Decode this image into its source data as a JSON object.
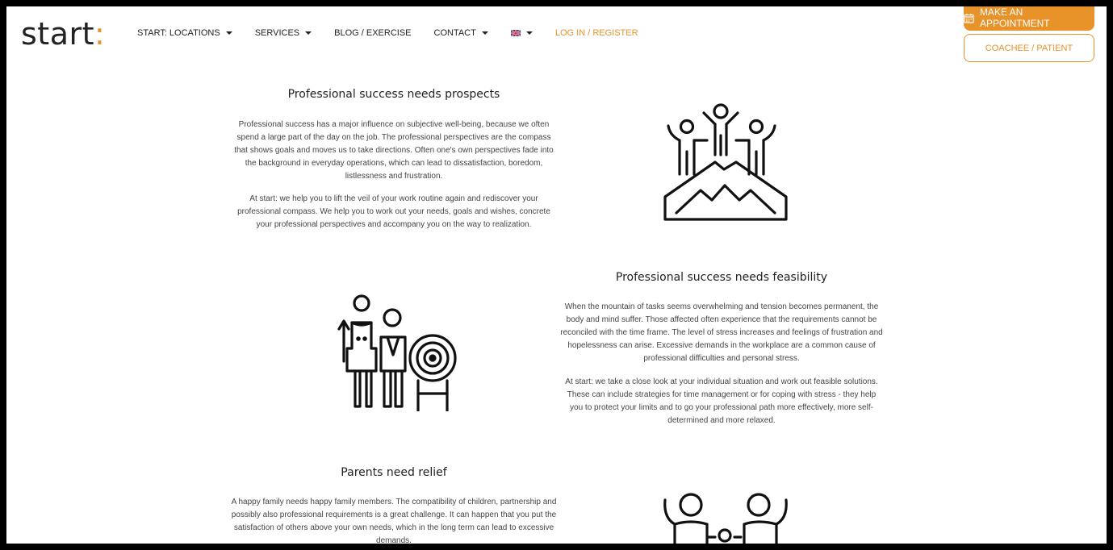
{
  "logo": {
    "word": "start",
    "colon": ":"
  },
  "nav": {
    "items": [
      {
        "label": "START: LOCATIONS"
      },
      {
        "label": "SERVICES"
      },
      {
        "label": "BLOG / EXERCISE"
      },
      {
        "label": "CONTACT"
      }
    ],
    "login": "LOG IN / REGISTER"
  },
  "header_buttons": {
    "appointment": "MAKE AN APPOINTMENT",
    "coachee": "COACHEE / PATIENT"
  },
  "sections": [
    {
      "heading": "Professional success needs prospects",
      "paragraphs": [
        "Professional success has a major influence on subjective well-being, because we often spend a large part of the day on the job. The professional perspectives are the compass that shows goals and moves us to take directions. Often one's own perspectives fade into the background in everyday operations, which can lead to dissatisfaction, boredom, listlessness and frustration.",
        "At start: we help you to lift the veil of your work routine again and rediscover your professional compass. We help you to work out your needs, goals and wishes, concrete your professional perspectives and accompany you on the way to realization."
      ]
    },
    {
      "heading": "Professional success needs feasibility",
      "paragraphs": [
        "When the mountain of tasks seems overwhelming and tension becomes permanent, the body and mind suffer. Those affected often experience that the requirements cannot be reconciled with the time frame. The level of stress increases and feelings of frustration and hopelessness can arise. Excessive demands in the workplace are a common cause of professional difficulties and personal stress.",
        "At start: we take a close look at your individual situation and work out feasible solutions. These can include strategies for time management or for coping with stress - they help you to protect your limits and to go your professional path more effectively, more self-determined and more relaxed."
      ]
    },
    {
      "heading": "Parents need relief",
      "paragraphs": [
        "A happy family needs happy family members. The compatibility of children, partnership and possibly also professional requirements is a great challenge. It can happen that you put the satisfaction of others above your own needs, which in the long term can lead to excessive demands."
      ]
    }
  ],
  "colors": {
    "accent": "#e8922a",
    "text": "#222222",
    "body_text": "#444444"
  },
  "icons": [
    "chevron-down-icon",
    "uk-flag-icon",
    "calendar-icon",
    "mountain-team-icon",
    "target-team-icon",
    "family-icon"
  ]
}
